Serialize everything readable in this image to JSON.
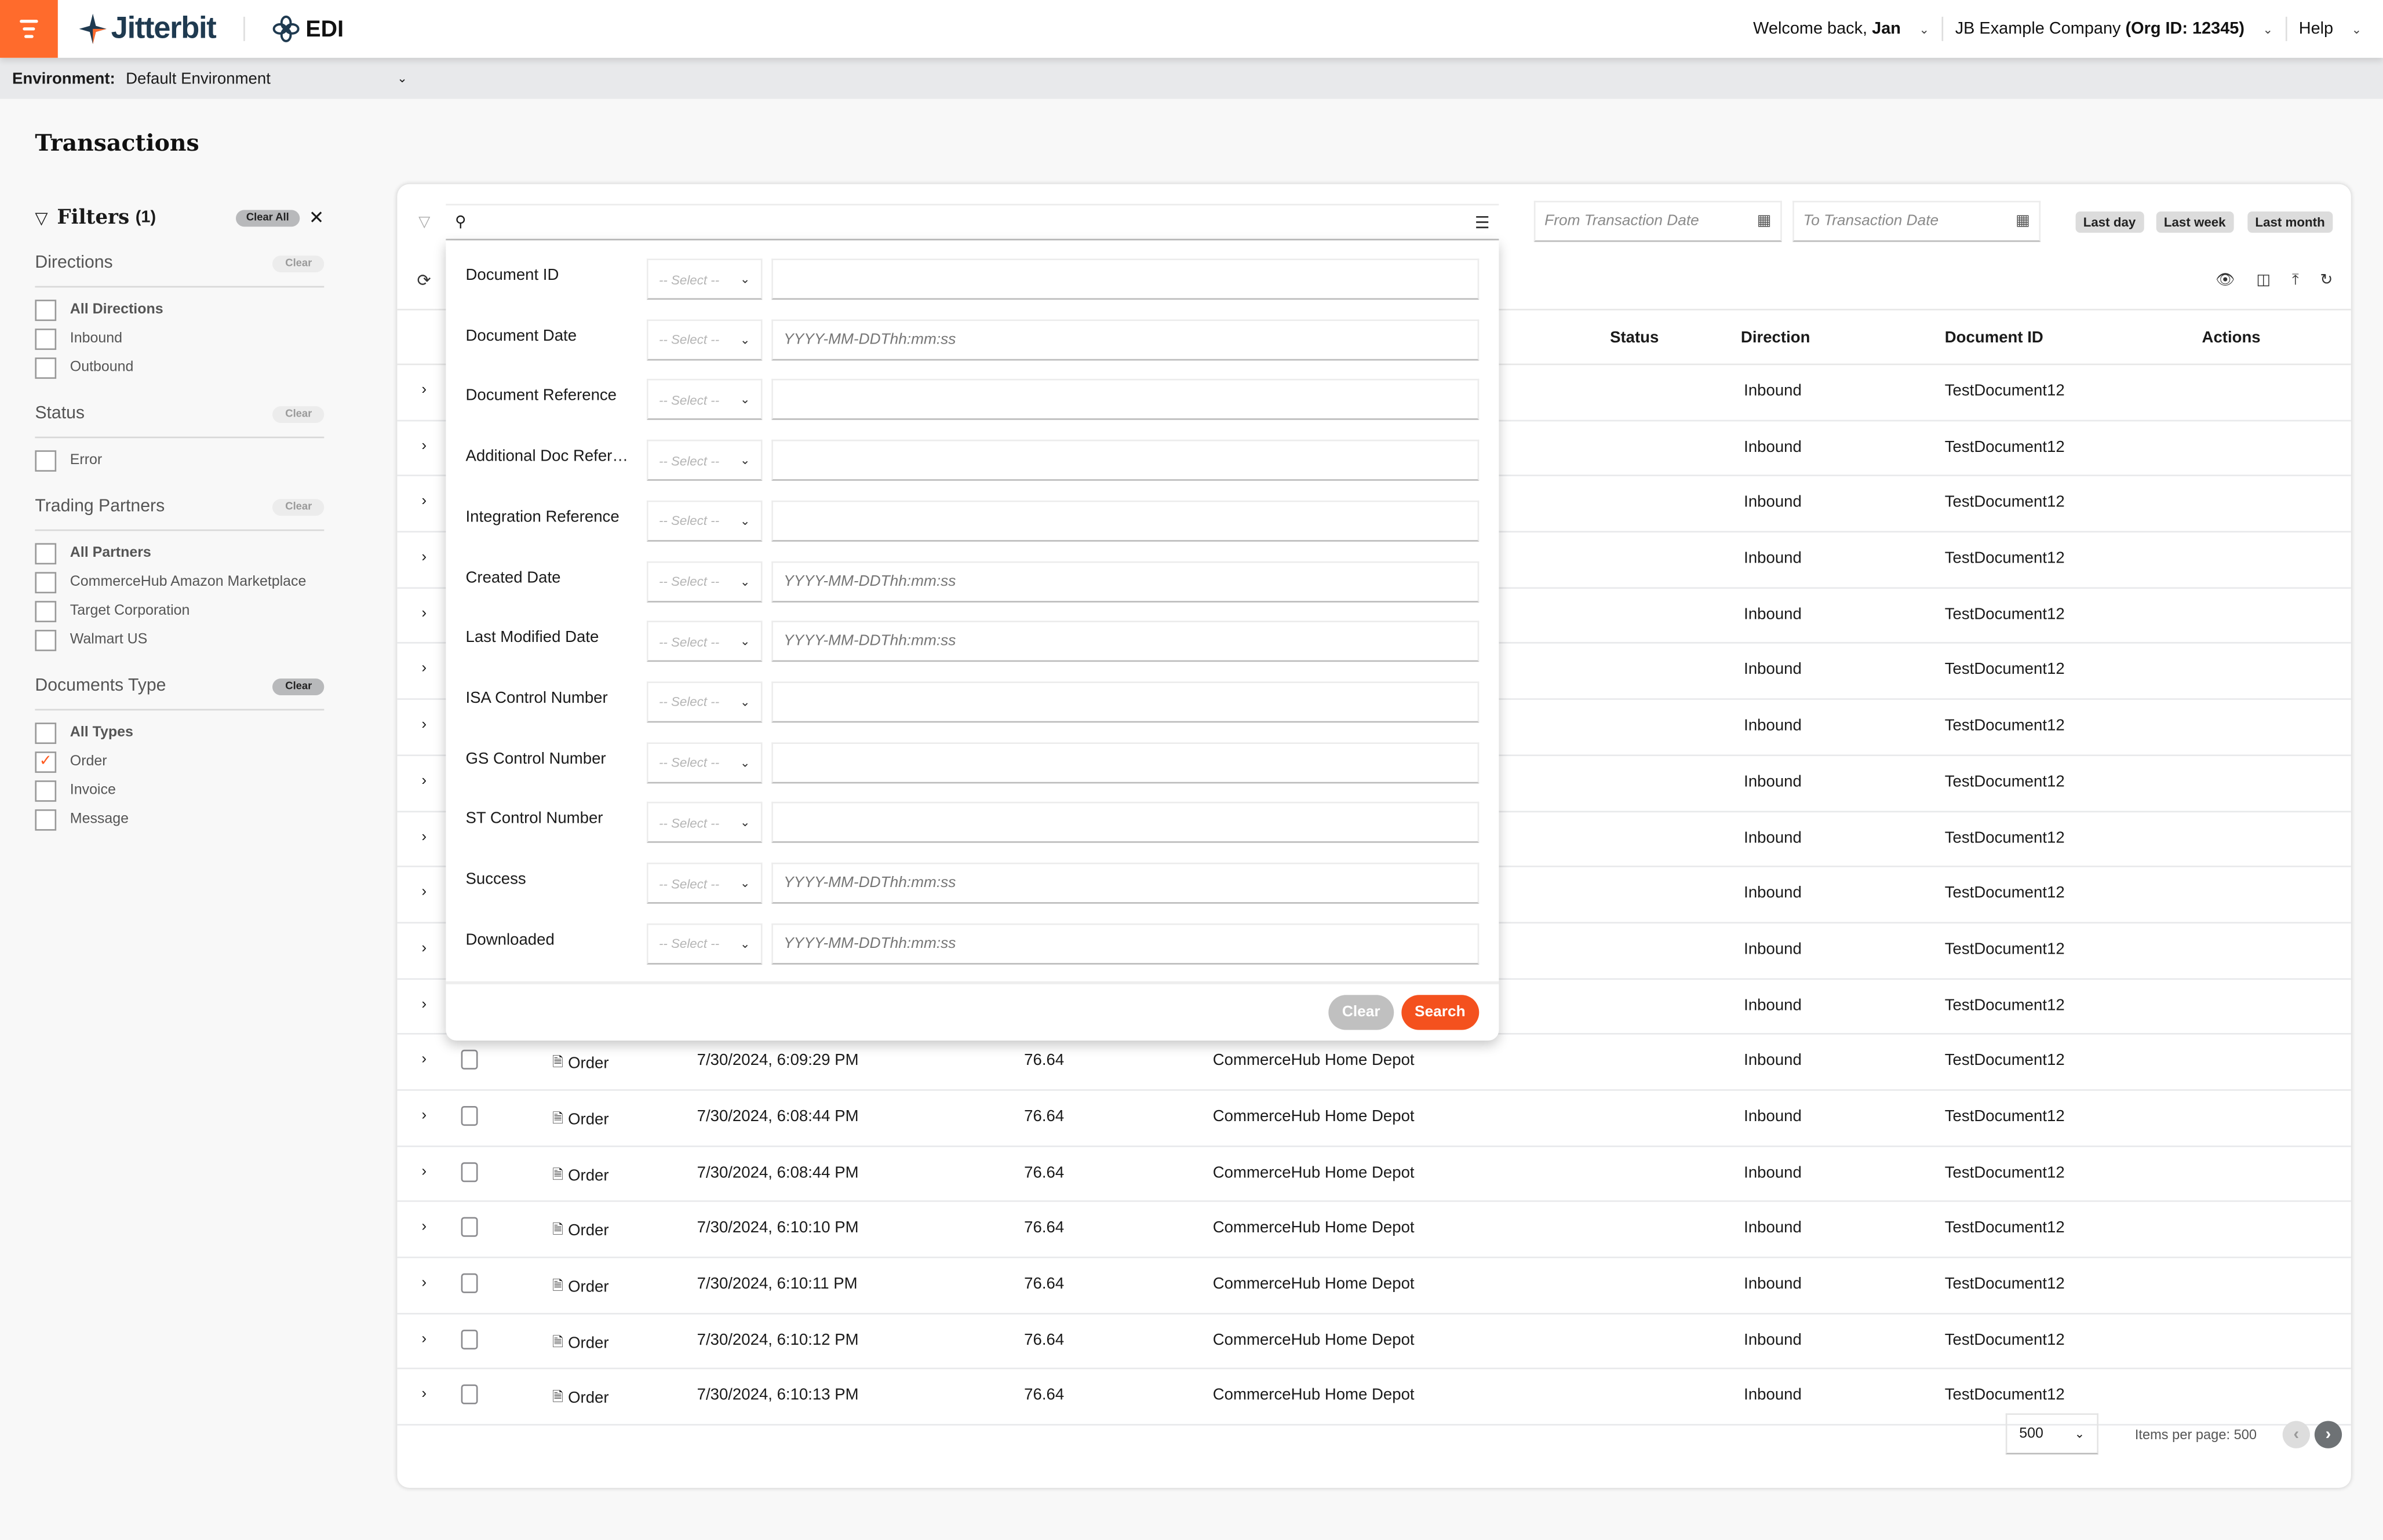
{
  "header": {
    "brand": "Jitterbit",
    "product": "EDI",
    "welcome_prefix": "Welcome back, ",
    "user_name": "Jan",
    "company": "JB Example Company ",
    "org_id": "(Org ID: 12345)",
    "help": "Help",
    "brand_color": "#ff6b2c"
  },
  "environment": {
    "label": "Environment:",
    "value": "Default Environment"
  },
  "page": {
    "title": "Transactions"
  },
  "filters": {
    "title": "Filters",
    "count": "(1)",
    "clear_all": "Clear All",
    "groups": [
      {
        "title": "Directions",
        "clear": "Clear",
        "active": false,
        "items": [
          {
            "label": "All Directions",
            "bold": true,
            "checked": false
          },
          {
            "label": "Inbound",
            "checked": false
          },
          {
            "label": "Outbound",
            "checked": false
          }
        ]
      },
      {
        "title": "Status",
        "clear": "Clear",
        "active": false,
        "items": [
          {
            "label": "Error",
            "checked": false
          }
        ]
      },
      {
        "title": "Trading Partners",
        "clear": "Clear",
        "active": false,
        "items": [
          {
            "label": "All Partners",
            "bold": true,
            "checked": false
          },
          {
            "label": "CommerceHub Amazon Marketplace",
            "checked": false
          },
          {
            "label": "Target Corporation",
            "checked": false
          },
          {
            "label": "Walmart US",
            "checked": false
          }
        ]
      },
      {
        "title": "Documents Type",
        "clear": "Clear",
        "active": true,
        "items": [
          {
            "label": "All Types",
            "bold": true,
            "checked": false
          },
          {
            "label": "Order",
            "checked": true
          },
          {
            "label": "Invoice",
            "checked": false
          },
          {
            "label": "Message",
            "checked": false
          }
        ]
      }
    ]
  },
  "toolbar": {
    "search_placeholder": "",
    "from_date_placeholder": "From Transaction Date",
    "to_date_placeholder": "To Transaction Date",
    "range_buttons": [
      "Last day",
      "Last week",
      "Last month"
    ]
  },
  "table": {
    "columns": {
      "status": "Status",
      "direction": "Direction",
      "document_id": "Document ID",
      "actions": "Actions"
    },
    "rows": [
      {
        "type": "",
        "date": "",
        "amount": "",
        "partner": "",
        "direction": "Inbound",
        "document_id": "TestDocument12"
      },
      {
        "type": "",
        "date": "",
        "amount": "",
        "partner": "",
        "direction": "Inbound",
        "document_id": "TestDocument12"
      },
      {
        "type": "",
        "date": "",
        "amount": "",
        "partner": "",
        "direction": "Inbound",
        "document_id": "TestDocument12"
      },
      {
        "type": "",
        "date": "",
        "amount": "",
        "partner": "",
        "direction": "Inbound",
        "document_id": "TestDocument12"
      },
      {
        "type": "",
        "date": "",
        "amount": "",
        "partner": "",
        "direction": "Inbound",
        "document_id": "TestDocument12"
      },
      {
        "type": "",
        "date": "",
        "amount": "",
        "partner": "",
        "direction": "Inbound",
        "document_id": "TestDocument12"
      },
      {
        "type": "",
        "date": "",
        "amount": "",
        "partner": "",
        "direction": "Inbound",
        "document_id": "TestDocument12"
      },
      {
        "type": "",
        "date": "",
        "amount": "",
        "partner": "",
        "direction": "Inbound",
        "document_id": "TestDocument12"
      },
      {
        "type": "",
        "date": "",
        "amount": "",
        "partner": "",
        "direction": "Inbound",
        "document_id": "TestDocument12"
      },
      {
        "type": "",
        "date": "",
        "amount": "",
        "partner": "",
        "direction": "Inbound",
        "document_id": "TestDocument12"
      },
      {
        "type": "",
        "date": "",
        "amount": "",
        "partner": "",
        "direction": "Inbound",
        "document_id": "TestDocument12"
      },
      {
        "type": "",
        "date": "",
        "amount": "",
        "partner": "",
        "direction": "Inbound",
        "document_id": "TestDocument12"
      },
      {
        "type": "Order",
        "date": "7/30/2024, 6:09:29 PM",
        "amount": "76.64",
        "partner": "CommerceHub Home Depot",
        "direction": "Inbound",
        "document_id": "TestDocument12"
      },
      {
        "type": "Order",
        "date": "7/30/2024, 6:08:44 PM",
        "amount": "76.64",
        "partner": "CommerceHub Home Depot",
        "direction": "Inbound",
        "document_id": "TestDocument12"
      },
      {
        "type": "Order",
        "date": "7/30/2024, 6:08:44 PM",
        "amount": "76.64",
        "partner": "CommerceHub Home Depot",
        "direction": "Inbound",
        "document_id": "TestDocument12"
      },
      {
        "type": "Order",
        "date": "7/30/2024, 6:10:10 PM",
        "amount": "76.64",
        "partner": "CommerceHub Home Depot",
        "direction": "Inbound",
        "document_id": "TestDocument12"
      },
      {
        "type": "Order",
        "date": "7/30/2024, 6:10:11 PM",
        "amount": "76.64",
        "partner": "CommerceHub Home Depot",
        "direction": "Inbound",
        "document_id": "TestDocument12"
      },
      {
        "type": "Order",
        "date": "7/30/2024, 6:10:12 PM",
        "amount": "76.64",
        "partner": "CommerceHub Home Depot",
        "direction": "Inbound",
        "document_id": "TestDocument12"
      },
      {
        "type": "Order",
        "date": "7/30/2024, 6:10:13 PM",
        "amount": "76.64",
        "partner": "CommerceHub Home Depot",
        "direction": "Inbound",
        "document_id": "TestDocument12"
      }
    ]
  },
  "pagination": {
    "per_page_value": "500",
    "items_per_page_label": "Items per page: 500"
  },
  "advanced_search": {
    "select_placeholder": "-- Select --",
    "fields": [
      {
        "label": "Document ID",
        "placeholder": ""
      },
      {
        "label": "Document Date",
        "placeholder": "YYYY-MM-DDThh:mm:ss"
      },
      {
        "label": "Document Reference",
        "placeholder": ""
      },
      {
        "label": "Additional Doc Reference",
        "placeholder": ""
      },
      {
        "label": "Integration Reference",
        "placeholder": ""
      },
      {
        "label": "Created Date",
        "placeholder": "YYYY-MM-DDThh:mm:ss"
      },
      {
        "label": "Last Modified Date",
        "placeholder": "YYYY-MM-DDThh:mm:ss"
      },
      {
        "label": "ISA Control Number",
        "placeholder": ""
      },
      {
        "label": "GS Control Number",
        "placeholder": ""
      },
      {
        "label": "ST Control Number",
        "placeholder": ""
      },
      {
        "label": "Success",
        "placeholder": "YYYY-MM-DDThh:mm:ss"
      },
      {
        "label": "Downloaded",
        "placeholder": "YYYY-MM-DDThh:mm:ss"
      }
    ],
    "clear_label": "Clear",
    "search_label": "Search",
    "search_color": "#f4511e"
  }
}
